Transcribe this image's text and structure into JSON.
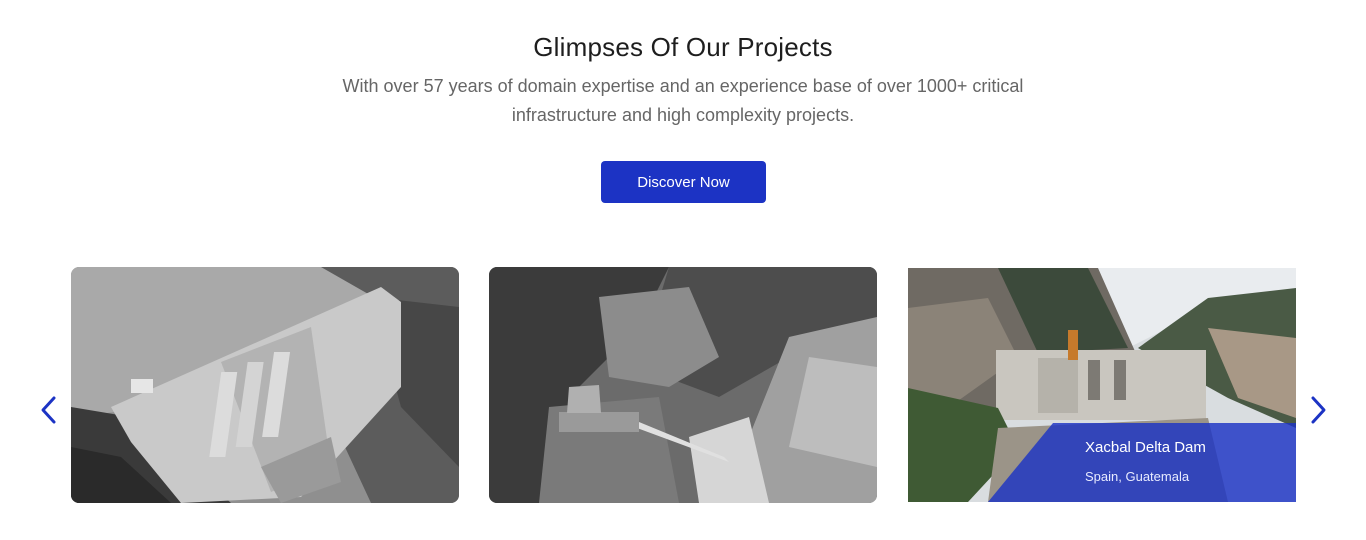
{
  "section": {
    "title": "Glimpses Of Our Projects",
    "subtitle_line1": "With over 57 years of domain expertise and an experience base of over 1000+ critical",
    "subtitle_line2": "infrastructure and high complexity projects.",
    "cta_label": "Discover Now"
  },
  "carousel": {
    "prev_icon": "chevron-left-icon",
    "next_icon": "chevron-right-icon",
    "accent_color": "#1c33c4",
    "cards": [
      {
        "image": "dam-grayscale-photo"
      },
      {
        "image": "gorge-bridge-grayscale-photo"
      },
      {
        "image": "dam-construction-color-photo",
        "name": "Xacbal Delta Dam",
        "location": "Spain, Guatemala"
      }
    ]
  }
}
